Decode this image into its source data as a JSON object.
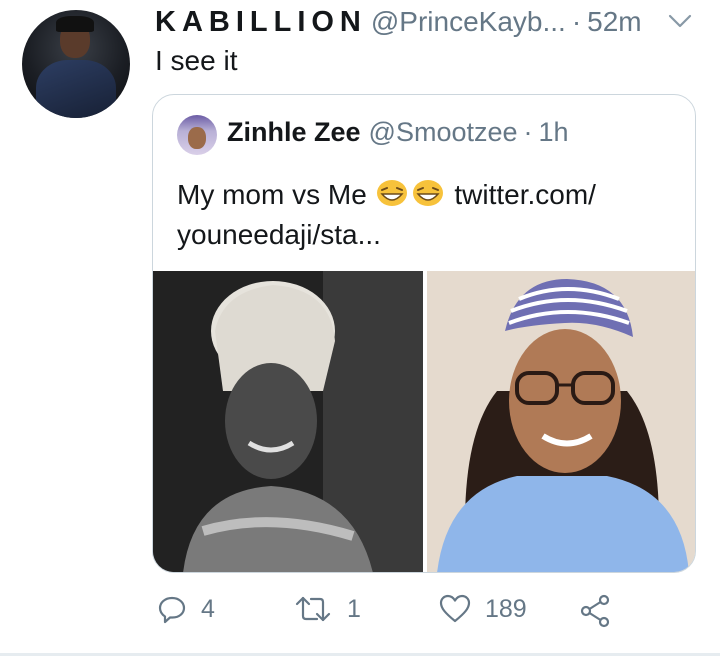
{
  "tweet": {
    "author_name": "KABILLION",
    "author_handle": "@PrinceKayb...",
    "separator": "·",
    "time": "52m",
    "text": "I see it"
  },
  "quoted_tweet": {
    "author_name": "Zinhle Zee",
    "author_handle": "@Smootzee",
    "separator": "·",
    "time": "1h",
    "text_before_emoji": "My mom vs Me",
    "text_after_emoji": "twitter.com/ youneedaji/sta..."
  },
  "actions": {
    "reply_count": "4",
    "retweet_count": "1",
    "like_count": "189"
  },
  "icons": [
    "avatar-image",
    "caret-down-icon",
    "grinning-squinting-face-emoji",
    "reply-icon",
    "retweet-icon",
    "like-icon",
    "share-icon"
  ],
  "colors": {
    "text": "#14171a",
    "muted": "#657786",
    "border": "#ccd6dd"
  }
}
